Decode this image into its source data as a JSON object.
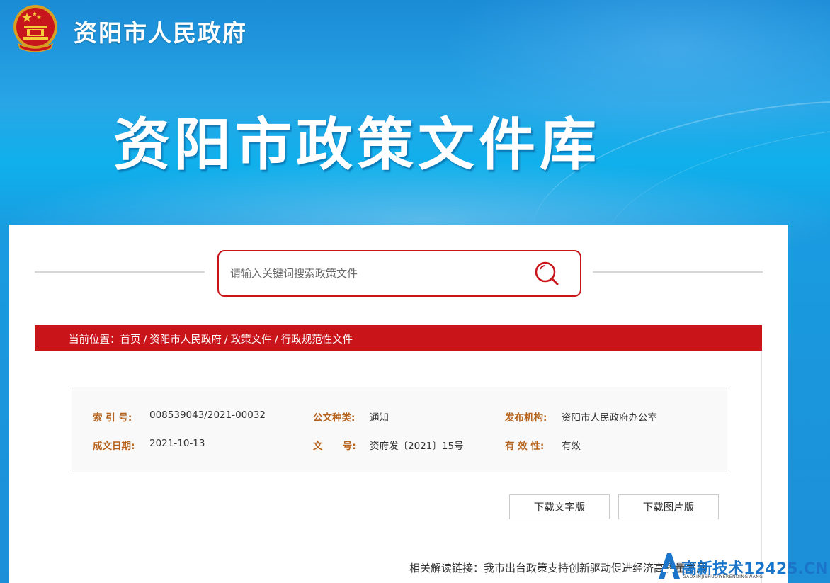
{
  "header": {
    "site_name": "资阳市人民政府",
    "banner_title": "资阳市政策文件库"
  },
  "search": {
    "placeholder": "请输入关键词搜索政策文件"
  },
  "breadcrumb": {
    "prefix": "当前位置：",
    "items": [
      "首页",
      "资阳市人民政府",
      "政策文件",
      "行政规范性文件"
    ],
    "separator": "/"
  },
  "meta": {
    "index_label": "索 引 号:",
    "index_value": "008539043/2021-00032",
    "doc_type_label": "公文种类:",
    "doc_type_value": "通知",
    "issuer_label": "发布机构:",
    "issuer_value": "资阳市人民政府办公室",
    "date_label": "成文日期:",
    "date_value": "2021-10-13",
    "doc_no_label": "文      号:",
    "doc_no_value": "资府发〔2021〕15号",
    "validity_label": "有 效 性:",
    "validity_value": "有效"
  },
  "buttons": {
    "download_text": "下载文字版",
    "download_image": "下载图片版"
  },
  "related": {
    "label": "相关解读链接：",
    "link_text": "我市出台政策支持创新驱动促进经济高质量发展"
  },
  "watermark": {
    "text": "高新技术12425.CN",
    "sub": "GAOXINJISHUQIYERENDINGWANG"
  },
  "colors": {
    "brand_red": "#c9141a",
    "label_brown": "#b5631d",
    "sky_blue": "#1c8fd8"
  }
}
